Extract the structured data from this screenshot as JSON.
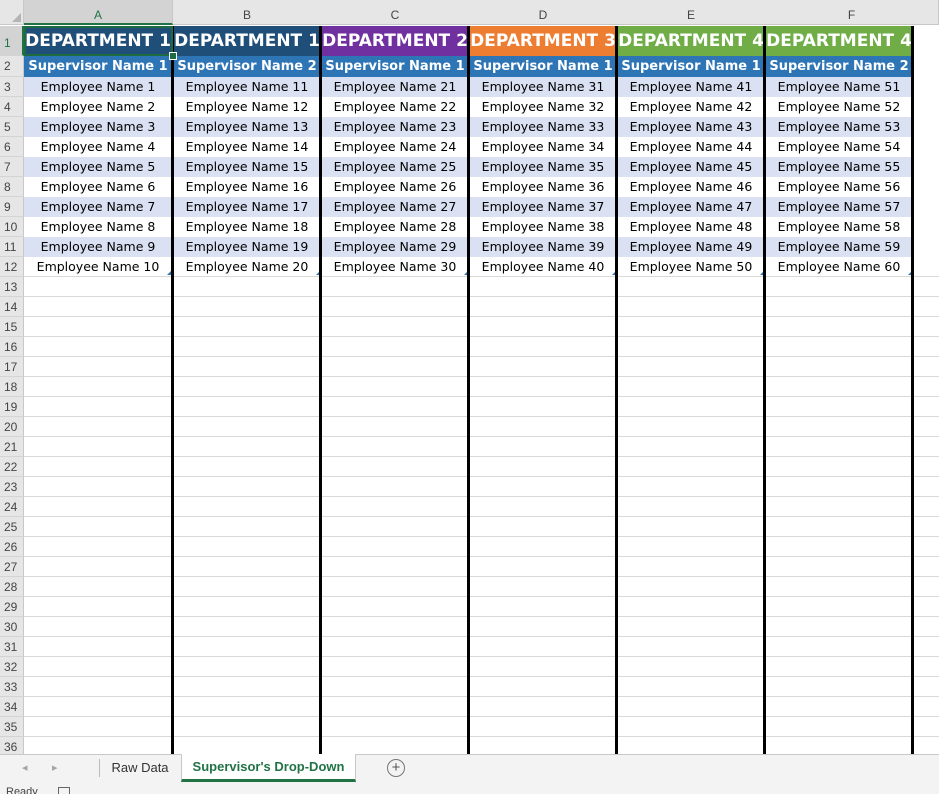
{
  "columns": [
    "A",
    "B",
    "C",
    "D",
    "E",
    "F"
  ],
  "row_numbers": [
    "1",
    "2",
    "3",
    "4",
    "5",
    "6",
    "7",
    "8",
    "9",
    "10",
    "11",
    "12",
    "13",
    "14",
    "15",
    "16",
    "17",
    "18",
    "19",
    "20",
    "21",
    "22",
    "23",
    "24",
    "25",
    "26",
    "27",
    "28",
    "29",
    "30",
    "31",
    "32",
    "33",
    "34",
    "35",
    "36"
  ],
  "departments": [
    {
      "label": "DEPARTMENT 1",
      "color": "#1f4e79"
    },
    {
      "label": "DEPARTMENT 1",
      "color": "#1f4e79"
    },
    {
      "label": "DEPARTMENT 2",
      "color": "#7030a0"
    },
    {
      "label": "DEPARTMENT 3",
      "color": "#ed7d31"
    },
    {
      "label": "DEPARTMENT 4",
      "color": "#70ad47"
    },
    {
      "label": "DEPARTMENT 4",
      "color": "#70ad47"
    }
  ],
  "supervisors": [
    "Supervisor Name 1",
    "Supervisor Name 2",
    "Supervisor Name 1",
    "Supervisor Name 1",
    "Supervisor Name 1",
    "Supervisor Name 2"
  ],
  "employees": [
    [
      "Employee Name 1",
      "Employee Name 2",
      "Employee Name 3",
      "Employee Name 4",
      "Employee Name 5",
      "Employee Name 6",
      "Employee Name 7",
      "Employee Name 8",
      "Employee Name 9",
      "Employee Name 10"
    ],
    [
      "Employee Name 11",
      "Employee Name 12",
      "Employee Name 13",
      "Employee Name 14",
      "Employee Name 15",
      "Employee Name 16",
      "Employee Name 17",
      "Employee Name 18",
      "Employee Name 19",
      "Employee Name 20"
    ],
    [
      "Employee Name 21",
      "Employee Name 22",
      "Employee Name 23",
      "Employee Name 24",
      "Employee Name 25",
      "Employee Name 26",
      "Employee Name 27",
      "Employee Name 28",
      "Employee Name 29",
      "Employee Name 30"
    ],
    [
      "Employee Name 31",
      "Employee Name 32",
      "Employee Name 33",
      "Employee Name 34",
      "Employee Name 35",
      "Employee Name 36",
      "Employee Name 37",
      "Employee Name 38",
      "Employee Name 39",
      "Employee Name 40"
    ],
    [
      "Employee Name 41",
      "Employee Name 42",
      "Employee Name 43",
      "Employee Name 44",
      "Employee Name 45",
      "Employee Name 46",
      "Employee Name 47",
      "Employee Name 48",
      "Employee Name 49",
      "Employee Name 50"
    ],
    [
      "Employee Name 51",
      "Employee Name 52",
      "Employee Name 53",
      "Employee Name 54",
      "Employee Name 55",
      "Employee Name 56",
      "Employee Name 57",
      "Employee Name 58",
      "Employee Name 59",
      "Employee Name 60"
    ]
  ],
  "band_color": "#d9e1f2",
  "accent_color": "#217346",
  "tabs": {
    "nav_prev": "◂",
    "nav_next": "▸",
    "sheets": [
      {
        "label": "Raw Data",
        "active": false
      },
      {
        "label": "Supervisor's Drop-Down",
        "active": true
      }
    ],
    "add_icon": "+"
  },
  "status": {
    "text": "Ready"
  }
}
